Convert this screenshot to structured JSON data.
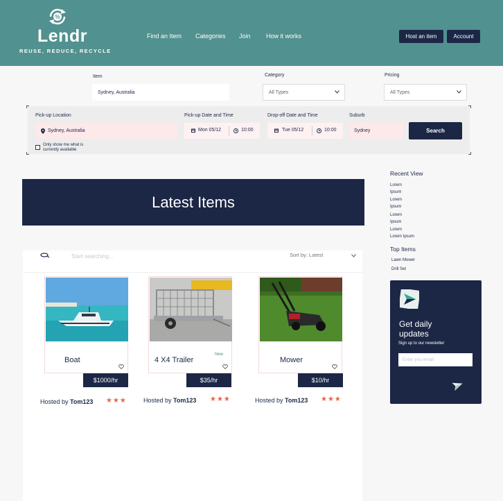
{
  "brand": {
    "name": "Lendr",
    "tagline": "REUSE, REDUCE, RECYCLE",
    "logo_icon": "percent-recycle-icon"
  },
  "nav": {
    "find": "Find an Item",
    "categories": "Categories",
    "join": "Join",
    "how": "How it works"
  },
  "header_buttons": {
    "host": "Host an item",
    "account": "Account"
  },
  "filters": {
    "item_label": "Item",
    "item_value": "Sydney, Australia",
    "category_label": "Category",
    "category_value": "All Types",
    "pricing_label": "Pricing",
    "pricing_value": "All Types"
  },
  "booking": {
    "pickup_loc_label": "Pick-up Location",
    "pickup_loc_value": "Sydney, Australia",
    "pickup_dt_label": "Pick-up Date and Time",
    "pickup_date": "Mon 05/12",
    "pickup_time": "10:00",
    "dropoff_dt_label": "Drop-off Date and Time",
    "dropoff_date": "Tue 05/12",
    "dropoff_time": "10:00",
    "suburb_label": "Suburb",
    "suburb_value": "Sydney",
    "search_label": "Search",
    "available_only": "Only show me what is currently available"
  },
  "banner": {
    "title": "Latest Items"
  },
  "results": {
    "search_placeholder": "Start searching...",
    "sort_label": "Sort by: Latest"
  },
  "items": [
    {
      "title": "Boat",
      "price": "$1000/hr",
      "hosted_prefix": "Hosted by",
      "host": "Tom123",
      "stars": "★★★",
      "badge": ""
    },
    {
      "title": "4 X4 Trailer",
      "price": "$35/hr",
      "hosted_prefix": "Hosted by",
      "host": "Tom123",
      "stars": "★★★",
      "badge": "New"
    },
    {
      "title": "Mower",
      "price": "$10/hr",
      "hosted_prefix": "Hosted by",
      "host": "Tom123",
      "stars": "★★★",
      "badge": ""
    }
  ],
  "sidebar": {
    "recent_title": "Recent View",
    "recent": [
      {
        "line1": "Lorem",
        "line2": "Ipsum"
      },
      {
        "line1": "Lorem",
        "line2": "Ipsum"
      },
      {
        "line1": "Lorem",
        "line2": "Ipsum"
      },
      {
        "line1": "Lorem",
        "line2": "Lorem Ipsum"
      }
    ],
    "top_title": "Top Items",
    "top": [
      "Lawn Mower",
      "Drill Set"
    ]
  },
  "newsletter": {
    "title_line1": "Get daily",
    "title_line2": "updates",
    "subtitle": "Sign up to our newsletter",
    "placeholder": "Enter you email"
  },
  "colors": {
    "header": "#51918f",
    "navy": "#1c2746",
    "accent_pink": "#fde8ea",
    "star": "#e2674a",
    "logo_green": "#3aa79a"
  }
}
